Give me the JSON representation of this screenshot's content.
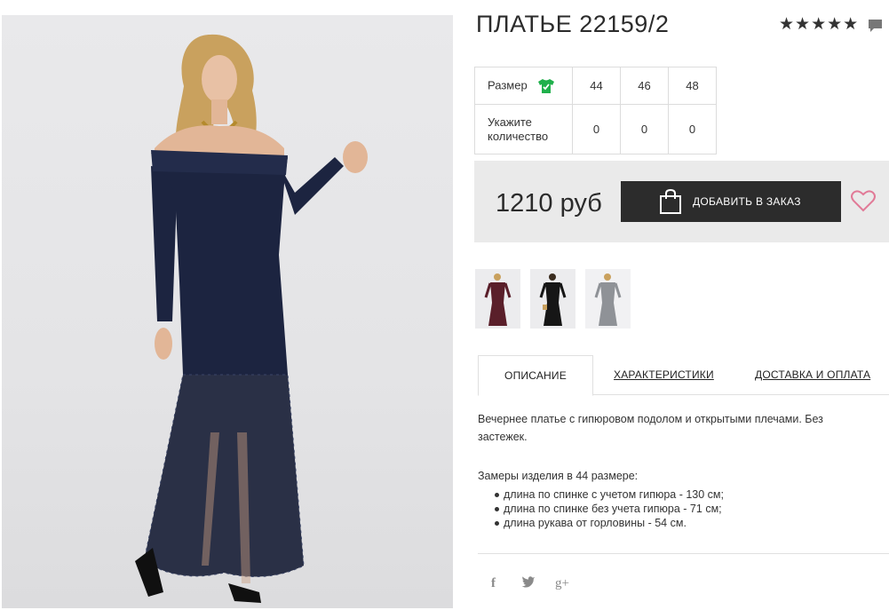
{
  "product": {
    "title": "ПЛАТЬЕ 22159/2",
    "rating_stars": "★★★★★",
    "rating_value": 5
  },
  "size_table": {
    "size_label": "Размер",
    "quantity_label": "Укажите количество",
    "sizes": [
      "44",
      "46",
      "48"
    ],
    "quantities": [
      "0",
      "0",
      "0"
    ]
  },
  "purchase": {
    "price": "1210 руб",
    "order_button_label": "ДОБАВИТЬ В ЗАКАЗ"
  },
  "colors": {
    "icon_green": "#1fb04b",
    "button_dark": "#2c2c2c",
    "price_bg": "#eaeaea",
    "heart": "#e17a97",
    "dress_navy": "#1c2440",
    "thumb_burgundy": "#5a1f2a",
    "thumb_black": "#161616",
    "thumb_grey": "#8f9297"
  },
  "thumbnails": [
    {
      "name": "thumbnail-burgundy-dress"
    },
    {
      "name": "thumbnail-black-dress"
    },
    {
      "name": "thumbnail-grey-dress"
    }
  ],
  "tabs": [
    {
      "label": "ОПИСАНИЕ",
      "active": true
    },
    {
      "label": "ХАРАКТЕРИСТИКИ",
      "active": false
    },
    {
      "label": "ДОСТАВКА И ОПЛАТА",
      "active": false
    }
  ],
  "description": {
    "text_line1": "Вечернее платье с гипюровом подолом и открытыми плечами. Без",
    "text_line2": "застежек.",
    "measures_title": "Замеры изделия в 44 размере:",
    "measures": [
      "длина по спинке с учетом гипюра - 130 см;",
      "длина по спинке без учета гипюра - 71 см;",
      "длина рукава от горловины - 54 см."
    ]
  },
  "social": {
    "facebook": "f",
    "googleplus": "g+"
  },
  "icons": [
    "comment-icon",
    "tshirt-icon",
    "shopping-bag-icon",
    "heart-icon",
    "facebook-icon",
    "twitter-icon",
    "googleplus-icon"
  ]
}
